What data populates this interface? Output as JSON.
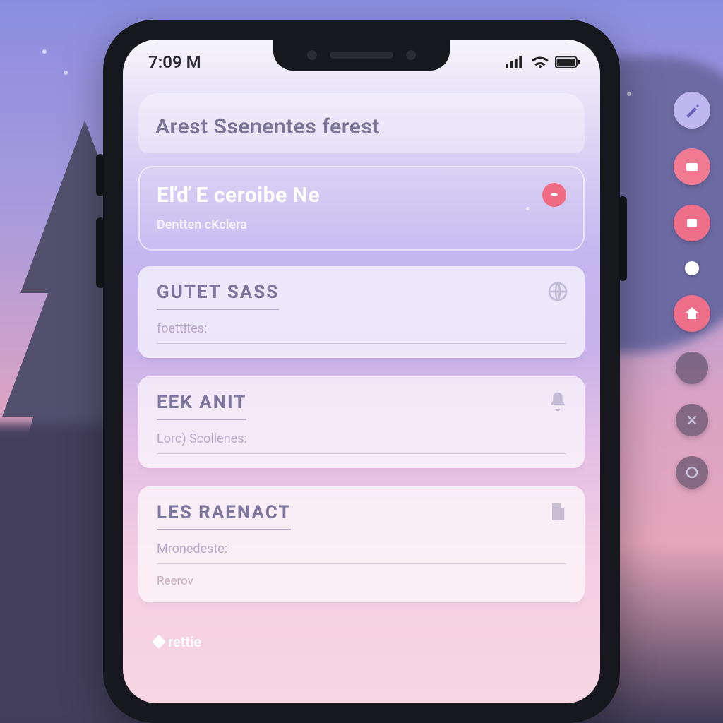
{
  "status": {
    "time": "7:09 M"
  },
  "header": {
    "title": "Arest Ssenentes ferest"
  },
  "hero": {
    "title": "Eľď E ceroibe Ne",
    "subtitle": "Dentten cKclera"
  },
  "cards": [
    {
      "title": "GUTET SASS",
      "subtitle": "foettites:",
      "icon": "globe-icon"
    },
    {
      "title": "EEK ANIT",
      "subtitle": "Lorc) Scollenes:",
      "icon": "bell-icon"
    },
    {
      "title": "LES RAENACT",
      "subtitle": "Mronedeste:",
      "subtitle2": "Reerov",
      "icon": "note-icon"
    }
  ],
  "footer": {
    "chip": "rettie"
  },
  "side_buttons": [
    {
      "name": "wand-icon",
      "style": "sb-lav"
    },
    {
      "name": "card-icon",
      "style": "sb-pink"
    },
    {
      "name": "window-icon",
      "style": "sb-pink2"
    },
    {
      "name": "dot-icon",
      "style": "sb-small-white"
    },
    {
      "name": "home-icon",
      "style": "sb-pink2"
    },
    {
      "name": "blank-icon",
      "style": "sb-gray"
    },
    {
      "name": "close-icon",
      "style": "sb-gray"
    },
    {
      "name": "circle-icon",
      "style": "sb-gray"
    }
  ],
  "colors": {
    "accent_pink": "#ef6b84",
    "accent_lav": "#7d77a0"
  }
}
